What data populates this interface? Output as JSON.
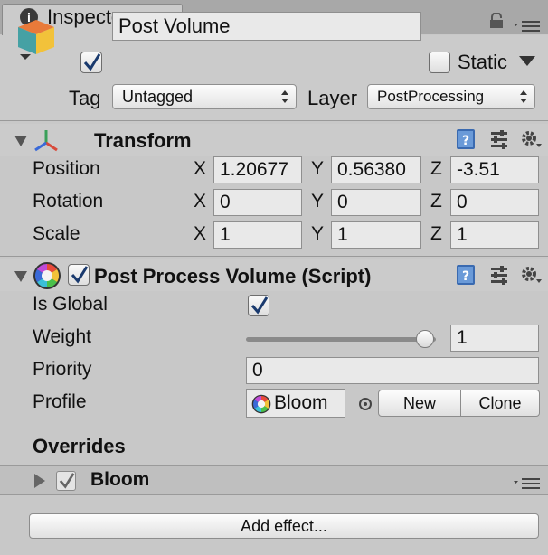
{
  "tab": {
    "icon": "info-icon",
    "label": "Inspector"
  },
  "header": {
    "active": true,
    "name": "Post Volume",
    "static_label": "Static",
    "tag_label": "Tag",
    "tag_value": "Untagged",
    "layer_label": "Layer",
    "layer_value": "PostProcessing"
  },
  "transform": {
    "title": "Transform",
    "rows": [
      {
        "label": "Position",
        "x": "1.20677",
        "y": "0.56380",
        "z": "-3.51"
      },
      {
        "label": "Rotation",
        "x": "0",
        "y": "0",
        "z": "0"
      },
      {
        "label": "Scale",
        "x": "1",
        "y": "1",
        "z": "1"
      }
    ],
    "axes": {
      "x": "X",
      "y": "Y",
      "z": "Z"
    }
  },
  "volume": {
    "title": "Post Process Volume (Script)",
    "enabled": true,
    "is_global_label": "Is Global",
    "is_global": true,
    "weight_label": "Weight",
    "weight_value": "1",
    "weight_fraction": 1.0,
    "priority_label": "Priority",
    "priority_value": "0",
    "profile_label": "Profile",
    "profile_value": "Bloom",
    "new_label": "New",
    "clone_label": "Clone",
    "overrides_label": "Overrides",
    "override_item": "Bloom",
    "add_effect_label": "Add effect..."
  },
  "colors": {
    "panel": "#cbcbcb",
    "tabbar": "#a8a8a8",
    "check": "#1a3a6e"
  }
}
